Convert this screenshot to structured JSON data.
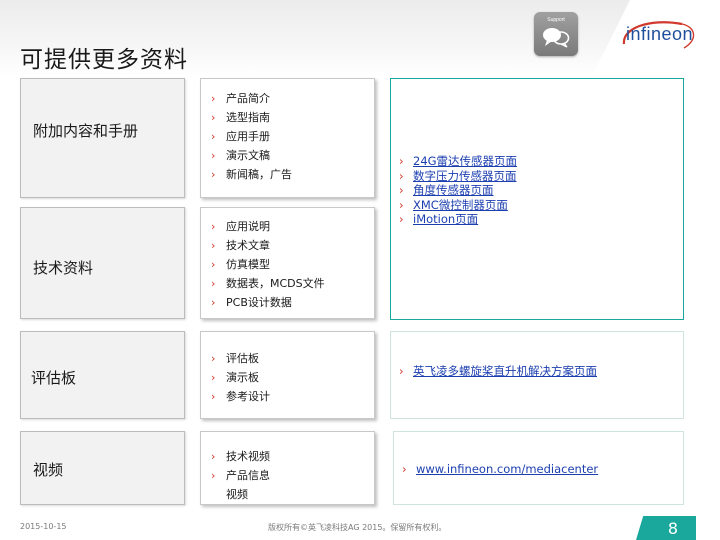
{
  "header": {
    "title": "可提供更多资料",
    "support_label": "Support",
    "support_icon": "chat-bubbles-icon",
    "logo_text": "infineon"
  },
  "rows": [
    {
      "category": "附加内容和手册",
      "items": [
        "产品简介",
        "选型指南",
        "应用手册",
        "演示文稿",
        "新闻稿，广告"
      ]
    },
    {
      "category": "技术资料",
      "items": [
        "应用说明",
        "技术文章",
        "仿真模型",
        "数据表，MCDS文件",
        "PCB设计数据"
      ]
    },
    {
      "category": "评估板",
      "items": [
        "评估板",
        "演示板",
        "参考设计"
      ]
    },
    {
      "category": "视频",
      "items": [
        "技术视频",
        "产品信息"
      ],
      "extra_line": "视频"
    }
  ],
  "links": {
    "group1": [
      "24G雷达传感器页面",
      "数字压力传感器页面",
      "角度传感器页面",
      "XMC微控制器页面",
      "iMotion页面"
    ],
    "group2": [
      "英飞凌多螺旋桨直升机解决方案页面"
    ],
    "group3": [
      "www.infineon.com/mediacenter"
    ]
  },
  "footer": {
    "date": "2015-10-15",
    "copyright": "版权所有©英飞凌科技AG 2015。保留所有权利。",
    "page_number": "8"
  },
  "colors": {
    "accent_teal": "#1aa79c",
    "bullet_red": "#d0392b",
    "link_blue": "#1c3fb0",
    "logo_blue": "#1f4f9c"
  }
}
